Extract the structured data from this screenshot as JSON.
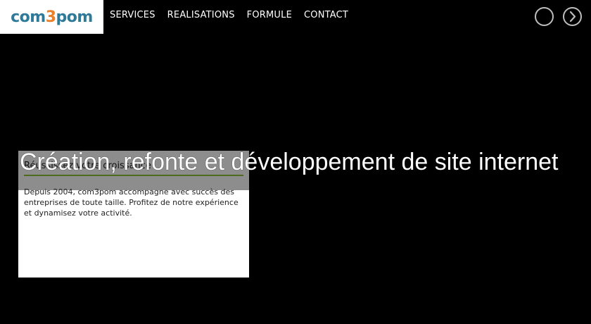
{
  "logo": {
    "part1": "com",
    "part2": "3",
    "part3": "pom"
  },
  "nav": {
    "items": [
      "SERVICES",
      "REALISATIONS",
      "FORMULE",
      "CONTACT"
    ]
  },
  "slider": {
    "prev_icon": "circle-icon",
    "next_icon": "chevron-right-circle-icon"
  },
  "card": {
    "heading": "Réussissez votre croissance",
    "body": "Depuis 2004, com3pom accompagne avec succès des entreprises de toute taille. Profitez de notre expérience et dynamisez votre activité."
  },
  "title": "Création, refonte et développement de site internet",
  "colors": {
    "logo_blue": "#2f7a98",
    "logo_orange": "#e9802a",
    "rule_green": "#4c6b1f"
  }
}
